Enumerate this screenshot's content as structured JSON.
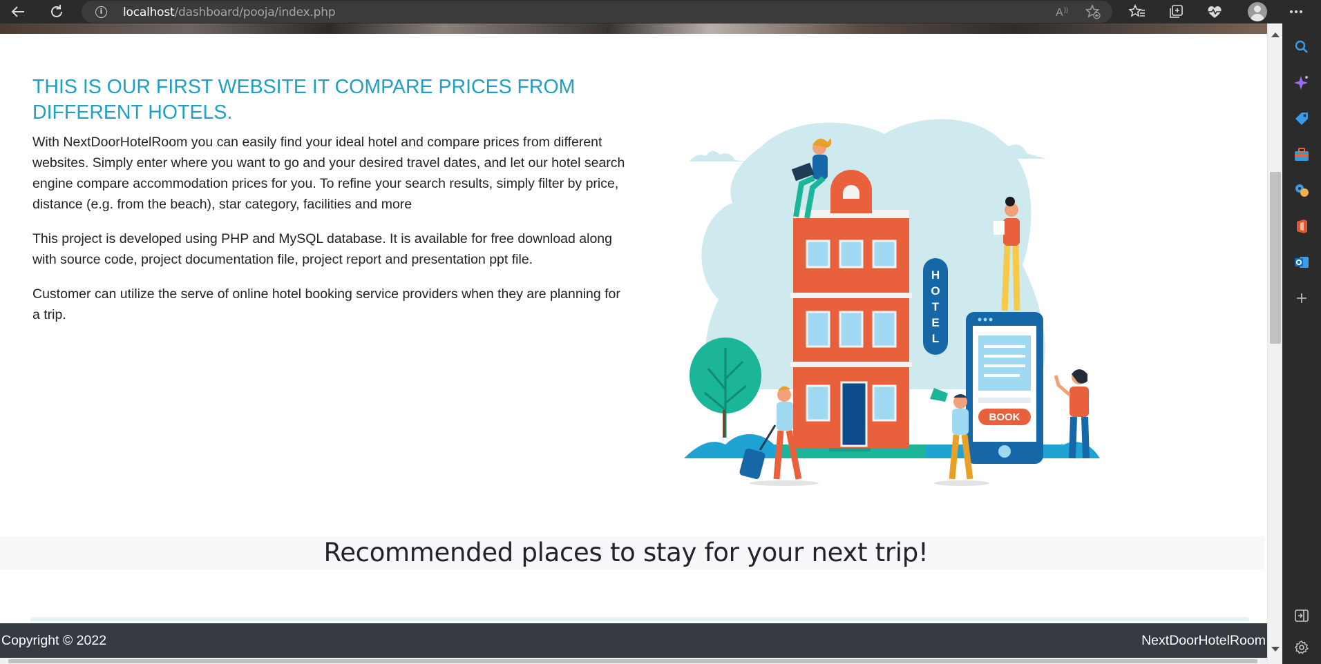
{
  "browser": {
    "url_host": "localhost",
    "url_path": "/dashboard/pooja/index.php"
  },
  "page": {
    "heading": "THIS IS OUR FIRST WEBSITE IT COMPARE PRICES FROM DIFFERENT HOTELS.",
    "paragraphs": [
      "With NextDoorHotelRoom you can easily find your ideal hotel and compare prices from different websites. Simply enter where you want to go and your desired travel dates, and let our hotel search engine compare accommodation prices for you. To refine your search results, simply filter by price, distance (e.g. from the beach), star category, facilities and more",
      "This project is developed using PHP and MySQL database. It is available for free download along with source code, project documentation file, project report and presentation ppt file.",
      "Customer can utilize the serve of online hotel booking service providers when they are planning for a trip."
    ],
    "illustration": {
      "hotel_sign": "HOTEL",
      "book_button": "BOOK"
    },
    "recommend_title": "Recommended places to stay for your next trip!"
  },
  "footer": {
    "copyright": "Copyright © 2022",
    "brand": "NextDoorHotelRoom"
  },
  "colors": {
    "heading": "#1f9fc2",
    "footer_bg": "#343a40",
    "hotel_red": "#e8603c",
    "teal": "#1bb69a",
    "cloud": "#cfeaef"
  }
}
